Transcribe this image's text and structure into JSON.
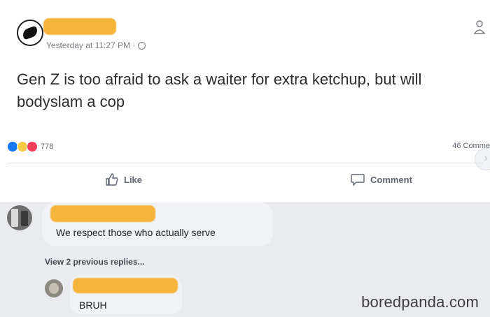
{
  "post": {
    "timestamp": "Yesterday at 11:27 PM ·",
    "text": "Gen Z is too afraid to ask a waiter for extra ketchup, but will bodyslam a cop",
    "reaction_count": "778",
    "comments_count": "46 Comme",
    "like_label": "Like",
    "comment_label": "Comment"
  },
  "comment": {
    "text": "We respect those who actually serve",
    "view_replies": "View 2 previous replies..."
  },
  "reply": {
    "text": "BRUH"
  },
  "watermark": "boredpanda.com",
  "colors": {
    "redaction": "#f5b43a",
    "like_blue": "#1877f2"
  }
}
